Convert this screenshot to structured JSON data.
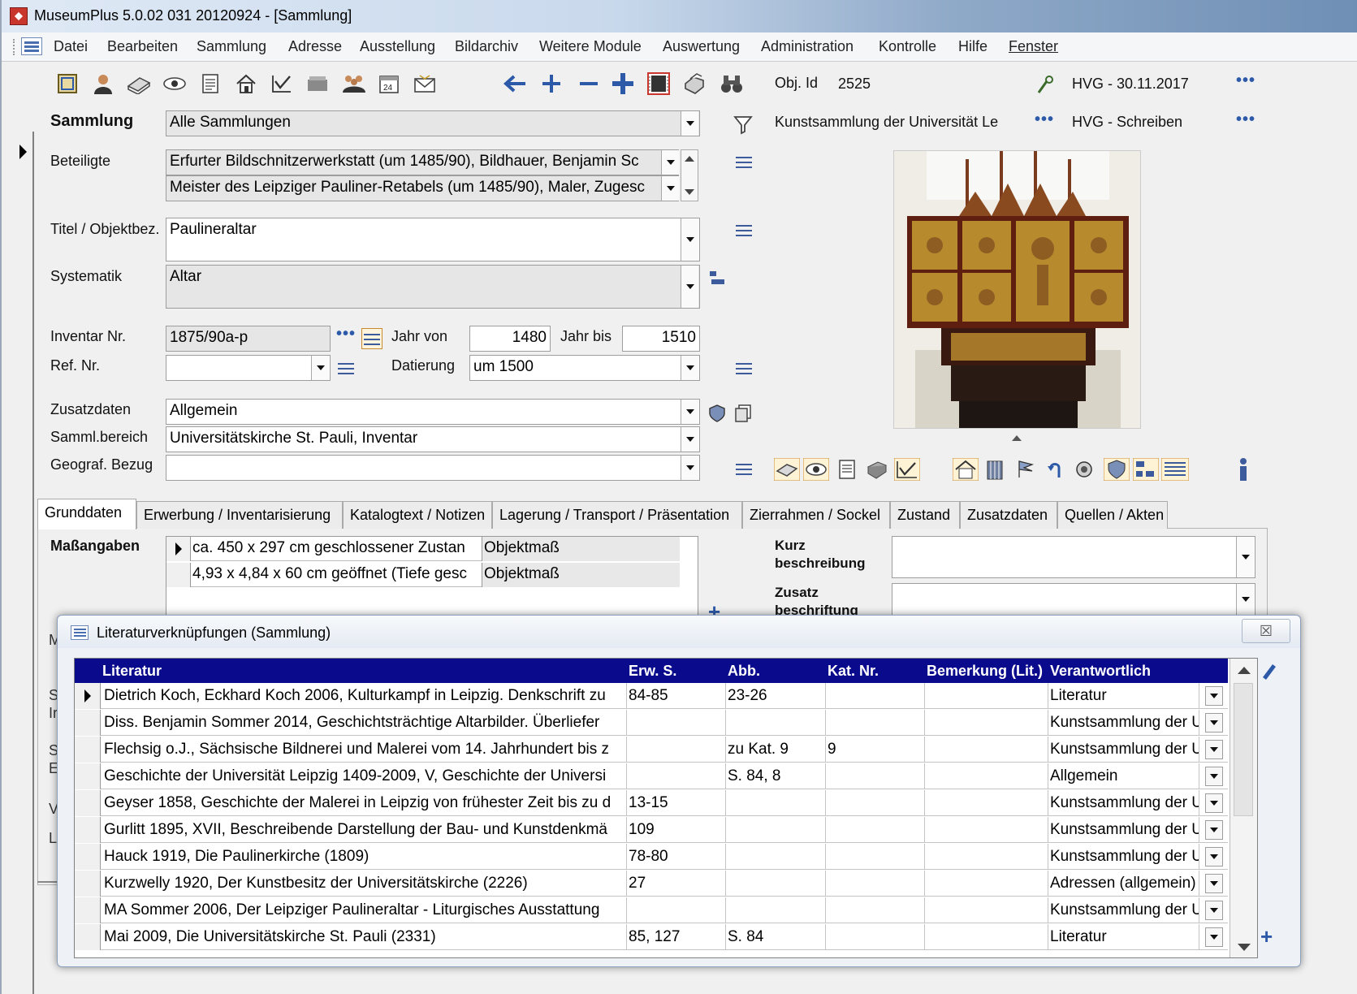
{
  "window": {
    "title": "MuseumPlus 5.0.02 031 20120924 - [Sammlung]"
  },
  "menu": [
    "Datei",
    "Bearbeiten",
    "Sammlung",
    "Adresse",
    "Ausstellung",
    "Bildarchiv",
    "Weitere Module",
    "Auswertung",
    "Administration",
    "Kontrolle",
    "Hilfe",
    "Fenster"
  ],
  "toolbar": {
    "icons": [
      "list-frame-icon",
      "person-icon",
      "books-icon",
      "eye-icon",
      "document-icon",
      "house-icon",
      "checkmark-chart-icon",
      "box-icon",
      "group-icon",
      "calendar-24-icon",
      "envelope-icon"
    ],
    "calendar_text": "24",
    "nav_icons": [
      "arrow-left-icon",
      "plus-icon",
      "minus-icon",
      "plus-bold-icon",
      "film-icon",
      "printer-icon",
      "binoculars-icon"
    ]
  },
  "header": {
    "obj_id_label": "Obj. Id",
    "obj_id_value": "2525",
    "hvg_date": "HVG - 30.11.2017",
    "collection_owner": "Kunstsammlung der Universität Le",
    "hvg_write": "HVG - Schreiben"
  },
  "form": {
    "sammlung_label": "Sammlung",
    "sammlung_value": "Alle Sammlungen",
    "beteiligte_label": "Beteiligte",
    "beteiligte": [
      "Erfurter Bildschnitzerwerkstatt (um 1485/90), Bildhauer, Benjamin Sc",
      "Meister des Leipziger Pauliner-Retabels (um 1485/90), Maler, Zugesc"
    ],
    "titel_label": "Titel / Objektbez.",
    "titel_value": "Paulineraltar",
    "systematik_label": "Systematik",
    "systematik_value": "Altar",
    "inventar_label": "Inventar Nr.",
    "inventar_value": "1875/90a-p",
    "jahr_von_label": "Jahr von",
    "jahr_von_value": "1480",
    "jahr_bis_label": "Jahr bis",
    "jahr_bis_value": "1510",
    "ref_label": "Ref. Nr.",
    "ref_value": "",
    "datierung_label": "Datierung",
    "datierung_value": "um 1500",
    "zusatzdaten_label": "Zusatzdaten",
    "zusatzdaten_value": "Allgemein",
    "sammlbereich_label": "Samml.bereich",
    "sammlbereich_value": "Universitätskirche St. Pauli, Inventar",
    "geograf_label": "Geograf. Bezug",
    "geograf_value": ""
  },
  "tabs": [
    "Grunddaten",
    "Erwerbung / Inventarisierung",
    "Katalogtext / Notizen",
    "Lagerung / Transport / Präsentation",
    "Zierrahmen / Sockel",
    "Zustand",
    "Zusatzdaten",
    "Quellen / Akten"
  ],
  "grunddaten": {
    "masse_label": "Maßangaben",
    "masse": [
      {
        "value": "ca. 450 x 297 cm geschlossener Zustan",
        "type": "Objektmaß"
      },
      {
        "value": "4,93 x 4,84 x 60 cm geöffnet (Tiefe gesc",
        "type": "Objektmaß"
      }
    ],
    "kurz_label_1": "Kurz",
    "kurz_label_2": "beschreibung",
    "zusatz_label_1": "Zusatz",
    "zusatz_label_2": "beschriftung"
  },
  "dialog": {
    "title": "Literaturverknüpfungen (Sammlung)",
    "close_glyph": "☒",
    "columns": [
      "Literatur",
      "Erw. S.",
      "Abb.",
      "Kat. Nr.",
      "Bemerkung (Lit.)",
      "Verantwortlich"
    ],
    "rows": [
      {
        "literatur": "Dietrich Koch, Eckhard Koch 2006, Kulturkampf in Leipzig. Denkschrift zu",
        "erw": "84-85",
        "abb": "23-26",
        "kat": "",
        "bem": "",
        "verantw": "Literatur"
      },
      {
        "literatur": "Diss. Benjamin Sommer 2014, Geschichtsträchtige Altarbilder. Überliefer",
        "erw": "",
        "abb": "",
        "kat": "",
        "bem": "",
        "verantw": "Kunstsammlung der U"
      },
      {
        "literatur": "Flechsig o.J., Sächsische Bildnerei und Malerei vom 14. Jahrhundert bis z",
        "erw": "",
        "abb": "zu Kat. 9",
        "kat": "9",
        "bem": "",
        "verantw": "Kunstsammlung der U"
      },
      {
        "literatur": "Geschichte der Universität Leipzig 1409-2009, V, Geschichte der Universi",
        "erw": "",
        "abb": "S. 84, 8",
        "kat": "",
        "bem": "",
        "verantw": "Allgemein"
      },
      {
        "literatur": "Geyser 1858, Geschichte der Malerei in Leipzig von frühester Zeit bis zu d",
        "erw": "13-15",
        "abb": "",
        "kat": "",
        "bem": "",
        "verantw": "Kunstsammlung der U"
      },
      {
        "literatur": "Gurlitt 1895, XVII, Beschreibende Darstellung der Bau- und Kunstdenkmä",
        "erw": "109",
        "abb": "",
        "kat": "",
        "bem": "",
        "verantw": "Kunstsammlung der U"
      },
      {
        "literatur": "Hauck 1919, Die Paulinerkirche (1809)",
        "erw": "78-80",
        "abb": "",
        "kat": "",
        "bem": "",
        "verantw": "Kunstsammlung der U"
      },
      {
        "literatur": "Kurzwelly 1920, Der Kunstbesitz der Universitätskirche (2226)",
        "erw": "27",
        "abb": "",
        "kat": "",
        "bem": "",
        "verantw": "Adressen (allgemein)"
      },
      {
        "literatur": "MA Sommer 2006, Der Leipziger Paulineraltar - Liturgisches Ausstattung",
        "erw": "",
        "abb": "",
        "kat": "",
        "bem": "",
        "verantw": "Kunstsammlung der U"
      },
      {
        "literatur": "Mai 2009, Die Universitätskirche St. Pauli (2331)",
        "erw": "85, 127",
        "abb": "S. 84",
        "kat": "",
        "bem": "",
        "verantw": "Literatur"
      }
    ]
  },
  "behind_dialog": {
    "letters": [
      "M",
      "S",
      "Ir",
      "S",
      "E",
      "V",
      "L"
    ]
  }
}
